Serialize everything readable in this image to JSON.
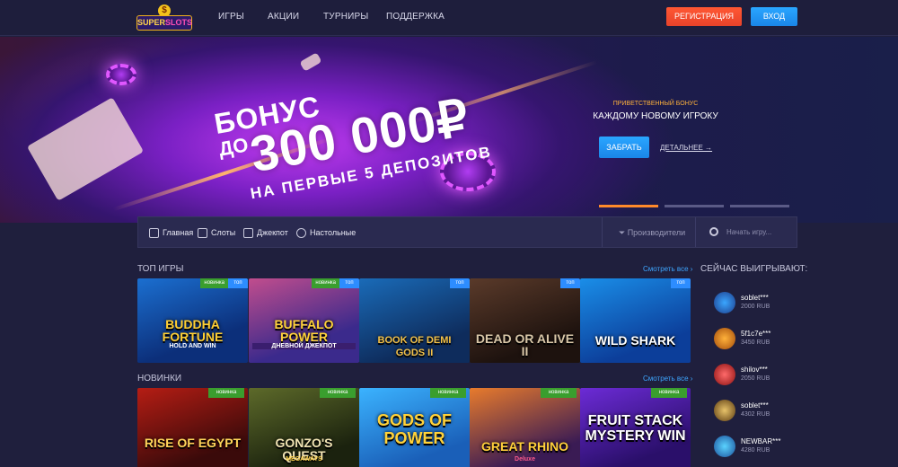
{
  "header": {
    "logo_top": "SUPER",
    "logo_bottom": "SLOTS",
    "logo_coin": "$",
    "nav": [
      "ИГРЫ",
      "АКЦИИ",
      "ТУРНИРЫ",
      "ПОДДЕРЖКА"
    ],
    "register_label": "РЕГИСТРАЦИЯ",
    "login_label": "ВХОД"
  },
  "banner": {
    "line1": "БОНУС",
    "line2": "ДО",
    "amount": "300 000₽",
    "line4": "НА ПЕРВЫЕ 5 ДЕПОЗИТОВ",
    "welcome_small": "ПРИВЕТСТВЕННЫЙ БОНУС",
    "welcome_title": "КАЖДОМУ НОВОМУ ИГРОКУ",
    "take_label": "ЗАБРАТЬ",
    "more_label": "ДЕТАЛЬНЕЕ →",
    "slides_total": 3,
    "slide_active": 1
  },
  "filters": {
    "items": [
      "Главная",
      "Слоты",
      "Джекпот",
      "Настольные"
    ],
    "providers": "Производители",
    "search_placeholder": "Начать игру..."
  },
  "top_games": {
    "title": "ТОП ИГРЫ",
    "see_all": "Смотреть все ›",
    "games": [
      {
        "name": "BUDDHA FORTUNE",
        "sub": "HOLD AND WIN",
        "badges": [
          "топ",
          "новинка"
        ]
      },
      {
        "name": "BUFFALO POWER",
        "sub": "ДНЕВНОЙ ДЖЕКПОТ",
        "badges": [
          "топ",
          "новинка"
        ]
      },
      {
        "name": "BOOK OF DEMI GODS II",
        "sub": "",
        "badges": [
          "топ"
        ]
      },
      {
        "name": "DEAD OR ALIVE II",
        "sub": "",
        "badges": [
          "топ"
        ]
      },
      {
        "name": "WILD SHARK",
        "sub": "",
        "badges": [
          "топ"
        ]
      }
    ]
  },
  "new_games": {
    "title": "НОВИНКИ",
    "see_all": "Смотреть все ›",
    "games": [
      {
        "name": "RISE OF EGYPT",
        "sub": "",
        "badges": [
          "новинка"
        ]
      },
      {
        "name": "GONZO'S QUEST",
        "sub": "MEGAWAYS",
        "badges": [
          "новинка"
        ]
      },
      {
        "name": "GODS OF POWER",
        "sub": "",
        "badges": [
          "новинка"
        ]
      },
      {
        "name": "GREAT RHINO",
        "sub": "Deluxe",
        "badges": [
          "новинка"
        ]
      },
      {
        "name": "FRUIT STACK MYSTERY WIN",
        "sub": "",
        "badges": [
          "новинка"
        ]
      }
    ]
  },
  "winners": {
    "title": "СЕЙЧАС ВЫИГРЫВАЮТ:",
    "items": [
      {
        "name": "soblet***",
        "amount": "2000 RUB"
      },
      {
        "name": "5f1c7e***",
        "amount": "3450 RUB"
      },
      {
        "name": "shilov***",
        "amount": "2050 RUB"
      },
      {
        "name": "soblet***",
        "amount": "4302 RUB"
      },
      {
        "name": "NEWBAR***",
        "amount": "4280 RUB"
      }
    ]
  },
  "colors": {
    "bg": "#1f1f3d",
    "accent_orange": "#ff5733",
    "accent_blue": "#2aa6ff",
    "badge_top": "#2d8dff",
    "badge_new": "#3a9e2e"
  }
}
